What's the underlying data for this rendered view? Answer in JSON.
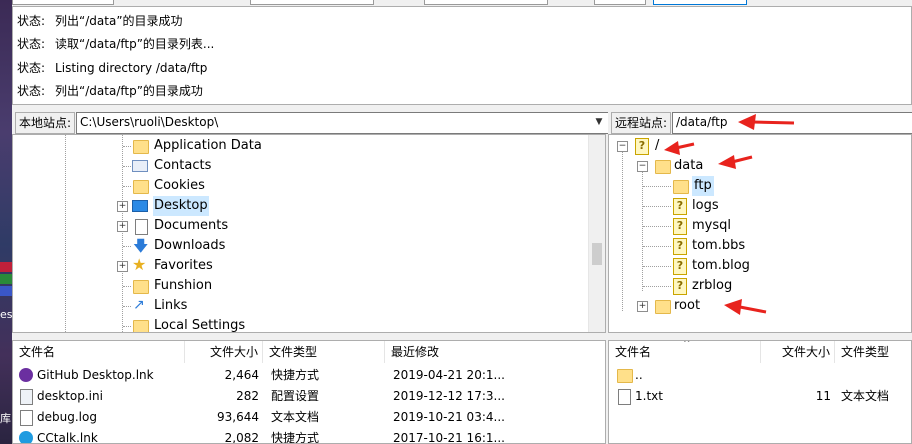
{
  "desktop": {
    "label_fragments": [
      "es",
      "库"
    ]
  },
  "status_log": {
    "rows": [
      {
        "key": "状态:",
        "msg": "列出“/data”的目录成功"
      },
      {
        "key": "状态:",
        "msg": "读取“/data/ftp”的目录列表..."
      },
      {
        "key": "状态:",
        "msg": "Listing directory /data/ftp"
      },
      {
        "key": "状态:",
        "msg": "列出“/data/ftp”的目录成功"
      }
    ]
  },
  "local": {
    "site_label": "本地站点:",
    "path": "C:\\Users\\ruoli\\Desktop\\",
    "tree_items": [
      {
        "label": "Application Data",
        "icon": "folder-icon"
      },
      {
        "label": "Contacts",
        "icon": "contacts-icon"
      },
      {
        "label": "Cookies",
        "icon": "folder-icon"
      },
      {
        "label": "Desktop",
        "icon": "desktop-folder-icon"
      },
      {
        "label": "Documents",
        "icon": "documents-icon"
      },
      {
        "label": "Downloads",
        "icon": "download-icon"
      },
      {
        "label": "Favorites",
        "icon": "star-icon"
      },
      {
        "label": "Funshion",
        "icon": "folder-icon"
      },
      {
        "label": "Links",
        "icon": "link-arrow-icon"
      },
      {
        "label": "Local Settings",
        "icon": "folder-icon"
      }
    ],
    "columns": [
      "文件名",
      "文件大小",
      "文件类型",
      "最近修改"
    ],
    "files": [
      {
        "name": "GitHub Desktop.lnk",
        "size": "2,464",
        "type": "快捷方式",
        "modified": "2019-04-21 20:1...",
        "icon": "github-icon"
      },
      {
        "name": "desktop.ini",
        "size": "282",
        "type": "配置设置",
        "modified": "2019-12-12 17:3...",
        "icon": "settings-file-icon"
      },
      {
        "name": "debug.log",
        "size": "93,644",
        "type": "文本文档",
        "modified": "2019-10-21 03:4...",
        "icon": "text-file-icon"
      },
      {
        "name": "CCtalk.lnk",
        "size": "2,082",
        "type": "快捷方式",
        "modified": "2017-10-21 16:1...",
        "icon": "cctalk-icon"
      }
    ]
  },
  "remote": {
    "site_label": "远程站点:",
    "path": "/data/ftp",
    "tree": {
      "root_label": "/",
      "data_label": "data",
      "children": [
        "ftp",
        "logs",
        "mysql",
        "tom.bbs",
        "tom.blog",
        "zrblog"
      ],
      "root_folder_label": "root"
    },
    "columns": [
      "文件名",
      "文件大小",
      "文件类型"
    ],
    "files": [
      {
        "name": "..",
        "size": "",
        "type": "",
        "icon": "folder-icon"
      },
      {
        "name": "1.txt",
        "size": "11",
        "type": "文本文档",
        "icon": "text-file-icon"
      }
    ]
  },
  "colors": {
    "annotation_arrow": "#e8231d",
    "selection": "#cce8ff",
    "folder": "#ffe08a"
  }
}
